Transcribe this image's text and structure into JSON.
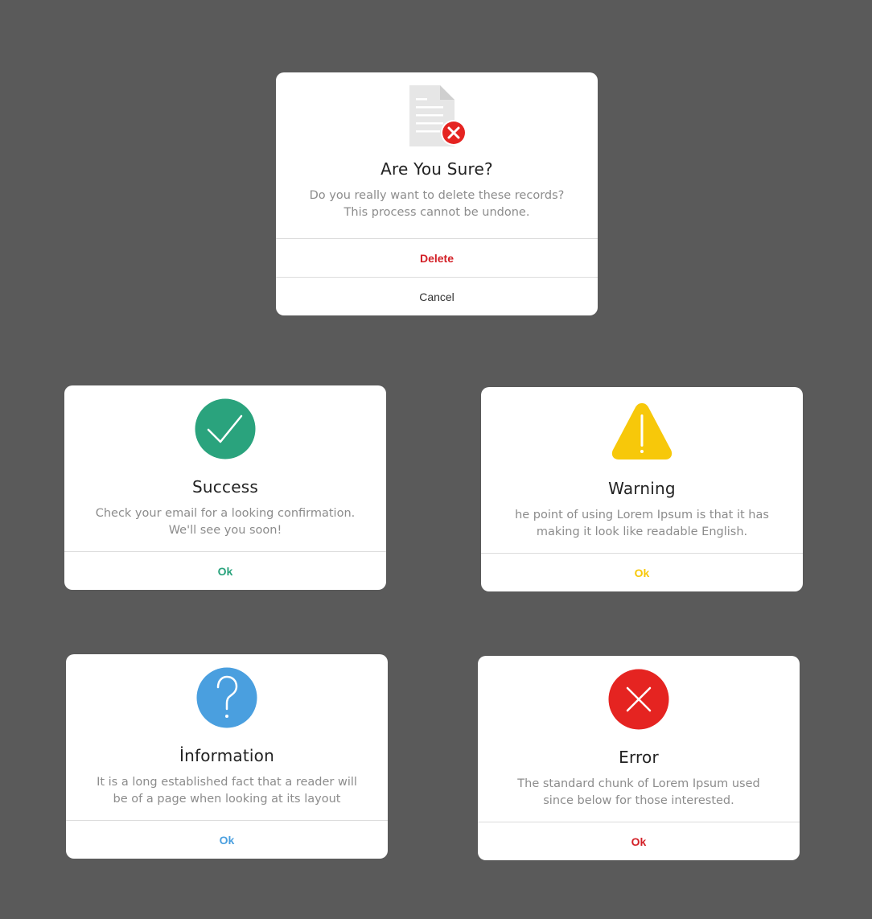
{
  "confirm": {
    "title": "Are You Sure?",
    "message_line1": "Do you really want to delete these records?",
    "message_line2": "This process cannot be undone.",
    "delete_label": "Delete",
    "cancel_label": "Cancel",
    "icon": "document-delete-icon",
    "accent": "#d32027"
  },
  "success": {
    "title": "Success",
    "message_line1": "Check your email for a looking confirmation.",
    "message_line2": "We'll see you soon!",
    "ok_label": "Ok",
    "icon": "check-circle-icon",
    "accent": "#2aa37d"
  },
  "warning": {
    "title": "Warning",
    "message_line1": "he point of using Lorem Ipsum is that it has",
    "message_line2": "making it look like readable English.",
    "ok_label": "Ok",
    "icon": "warning-triangle-icon",
    "accent": "#f7c80a"
  },
  "info": {
    "title": "İnformation",
    "message_line1": "It is a long established fact that a reader will",
    "message_line2": "be of a page when looking at its layout",
    "ok_label": "Ok",
    "icon": "question-circle-icon",
    "accent": "#4a9fdf"
  },
  "error": {
    "title": "Error",
    "message_line1": "The standard chunk of Lorem Ipsum used",
    "message_line2": "since below for those interested.",
    "ok_label": "Ok",
    "icon": "x-circle-icon",
    "accent": "#d32027"
  }
}
